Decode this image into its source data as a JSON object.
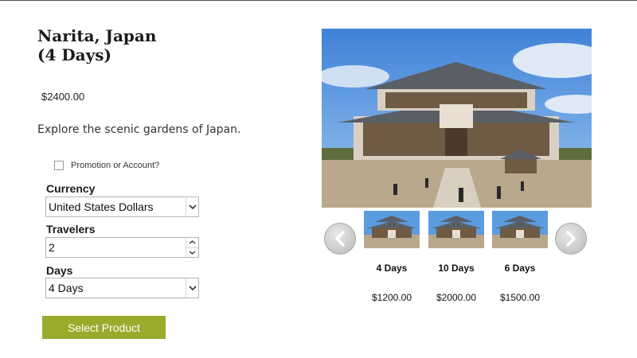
{
  "product": {
    "title_line1": "Narita, Japan",
    "title_line2": "(4 Days)",
    "price": "$2400.00",
    "description": "Explore the scenic gardens of Japan."
  },
  "promo": {
    "label": "Promotion or Account?",
    "checked": false
  },
  "currency": {
    "label": "Currency",
    "value": "United States Dollars"
  },
  "travelers": {
    "label": "Travelers",
    "value": "2"
  },
  "days": {
    "label": "Days",
    "value": "4 Days"
  },
  "select_button": "Select Product",
  "gallery": {
    "main_image": "temple-photo",
    "variants": [
      {
        "name": "4 Days",
        "price": "$1200.00"
      },
      {
        "name": "10 Days",
        "price": "$2000.00"
      },
      {
        "name": "6 Days",
        "price": "$1500.00"
      }
    ],
    "prev_icon": "chevron-left-icon",
    "next_icon": "chevron-right-icon"
  },
  "colors": {
    "button": "#9aaa2a",
    "sky": "#5d9be0"
  }
}
